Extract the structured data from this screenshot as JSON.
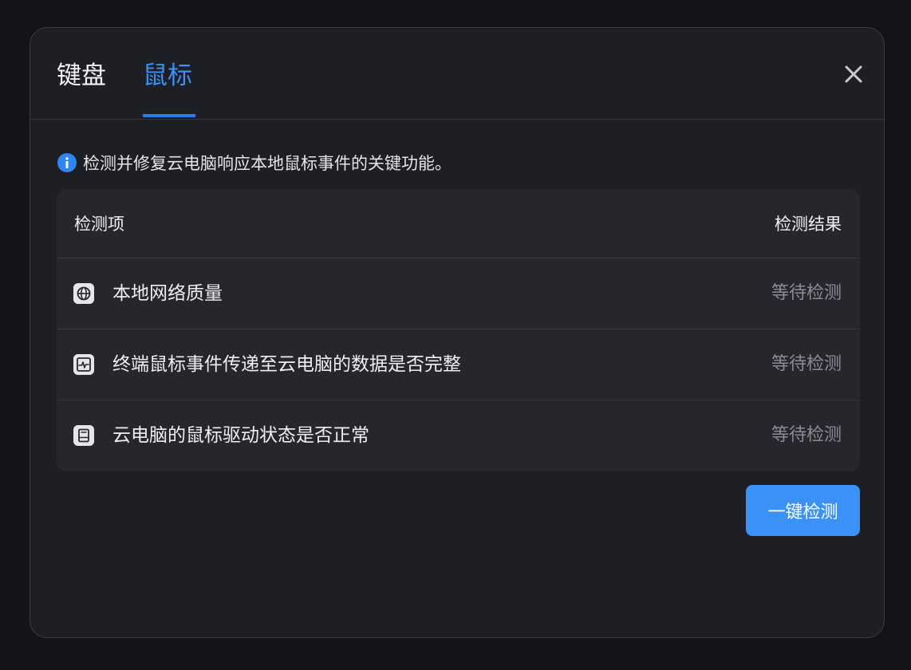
{
  "tabs": [
    {
      "label": "键盘",
      "active": false
    },
    {
      "label": "鼠标",
      "active": true
    }
  ],
  "hint": {
    "icon": "info-icon",
    "text": "检测并修复云电脑响应本地鼠标事件的关键功能。"
  },
  "table": {
    "headers": {
      "item": "检测项",
      "result": "检测结果"
    },
    "rows": [
      {
        "icon": "globe-icon",
        "label": "本地网络质量",
        "status": "等待检测"
      },
      {
        "icon": "activity-monitor-icon",
        "label": "终端鼠标事件传递至云电脑的数据是否完整",
        "status": "等待检测"
      },
      {
        "icon": "drive-icon",
        "label": "云电脑的鼠标驱动状态是否正常",
        "status": "等待检测"
      }
    ]
  },
  "actions": {
    "detect_button": "一键检测"
  },
  "colors": {
    "accent": "#3d8ef5",
    "button": "#3a91f6",
    "dialog_bg": "#1e1f24",
    "table_bg": "#26272d",
    "muted_text": "#8b8d95"
  }
}
